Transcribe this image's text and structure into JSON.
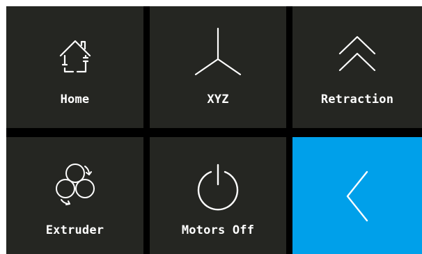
{
  "tiles": [
    {
      "label": "Home",
      "icon": "home-icon"
    },
    {
      "label": "XYZ",
      "icon": "xyz-axes-icon"
    },
    {
      "label": "Retraction",
      "icon": "double-chevron-up-icon"
    },
    {
      "label": "Extruder",
      "icon": "extruder-gears-icon"
    },
    {
      "label": "Motors Off",
      "icon": "power-icon"
    },
    {
      "label": "",
      "icon": "back-chevron-icon"
    }
  ],
  "colors": {
    "tile": "#252622",
    "accent": "#00a0ea",
    "background": "#000000",
    "foreground": "#ffffff"
  }
}
